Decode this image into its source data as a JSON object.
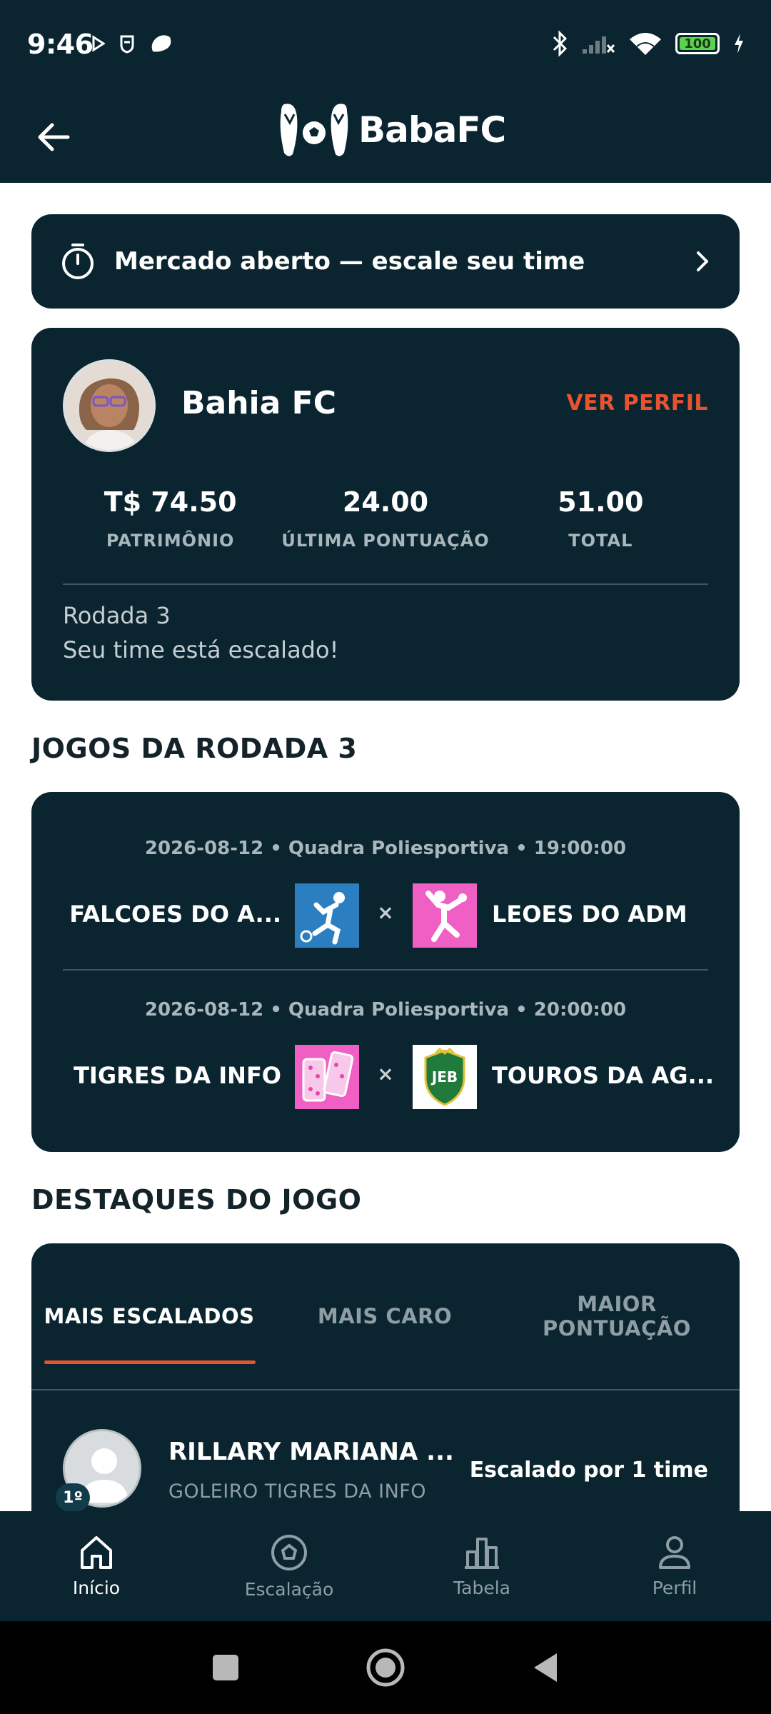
{
  "status_bar": {
    "time": "9:46",
    "battery": "100",
    "icons": [
      "play-icon",
      "shield-app-icon",
      "chat-bubble-icon",
      "bluetooth-icon",
      "signal-off-icon",
      "wifi-icon",
      "battery-icon",
      "charging-icon"
    ]
  },
  "app_bar": {
    "brand": "BabaFC",
    "back_icon": "back-arrow-icon",
    "logo_icon": "flipflops-soccer-ball-icon"
  },
  "market_banner": {
    "text": "Mercado aberto — escale seu time",
    "icon": "stopwatch-icon",
    "chevron": "chevron-right-icon"
  },
  "profile": {
    "team_name": "Bahia FC",
    "ver_perfil": "VER PERFIL",
    "stats": [
      {
        "value": "T$ 74.50",
        "label": "PATRIMÔNIO"
      },
      {
        "value": "24.00",
        "label": "ÚLTIMA PONTUAÇÃO"
      },
      {
        "value": "51.00",
        "label": "TOTAL"
      }
    ],
    "round": "Rodada 3",
    "round_status": "Seu time está escalado!"
  },
  "games_section": {
    "title": "JOGOS DA RODADA 3",
    "games": [
      {
        "meta": "2026-08-12 • Quadra Poliesportiva • 19:00:00",
        "home": "FALCOES DO A...",
        "away": "LEOES DO ADM",
        "vs": "×",
        "home_logo": "soccer-player-logo",
        "away_logo": "shot-put-logo"
      },
      {
        "meta": "2026-08-12 • Quadra Poliesportiva • 20:00:00",
        "home": "TIGRES DA INFO",
        "away": "TOUROS DA AG...",
        "vs": "×",
        "home_logo": "domino-logo",
        "away_logo": "jeb-shield-logo",
        "away_logo_text": "JEB"
      }
    ]
  },
  "highlights": {
    "title": "DESTAQUES DO JOGO",
    "tabs": [
      "MAIS ESCALADOS",
      "MAIS CARO",
      "MAIOR PONTUAÇÃO"
    ],
    "active_tab": "MAIS ESCALADOS",
    "items": [
      {
        "rank": "1º",
        "name": "RILLARY MARIANA ...",
        "position": "GOLEIRO TIGRES DA INFO",
        "count": "Escalado por 1 time"
      }
    ]
  },
  "bottom_nav": {
    "items": [
      {
        "label": "Início",
        "icon": "home-icon",
        "active": true
      },
      {
        "label": "Escalação",
        "icon": "soccer-ball-icon",
        "active": false
      },
      {
        "label": "Tabela",
        "icon": "bar-chart-icon",
        "active": false
      },
      {
        "label": "Perfil",
        "icon": "person-icon",
        "active": false
      }
    ]
  },
  "colors": {
    "primary_dark": "#0a2530",
    "accent": "#e8542f",
    "muted_text": "#a9b6bb"
  }
}
